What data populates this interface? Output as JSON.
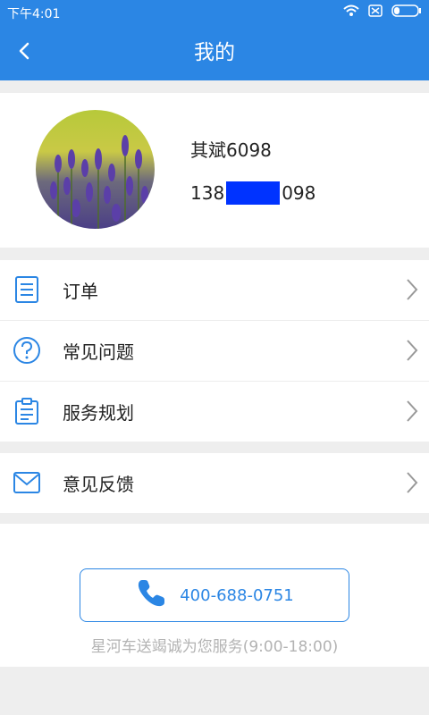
{
  "status_bar": {
    "time": "下午4:01",
    "icons": [
      "wifi-icon",
      "sim-off-icon",
      "battery-icon"
    ]
  },
  "header": {
    "title": "我的",
    "back_icon": "chevron-left-icon"
  },
  "profile": {
    "name": "其斌6098",
    "phone_prefix": "138",
    "phone_suffix": "098",
    "avatar_icon": "lavender-avatar"
  },
  "menu": [
    {
      "label": "订单",
      "icon": "order-list-icon"
    },
    {
      "label": "常见问题",
      "icon": "question-icon"
    },
    {
      "label": "服务规划",
      "icon": "clipboard-icon"
    }
  ],
  "menu2": [
    {
      "label": "意见反馈",
      "icon": "mail-icon"
    }
  ],
  "service": {
    "phone": "400-688-0751",
    "note": "星河车送竭诚为您服务(9:00-18:00)"
  },
  "colors": {
    "primary": "#2b86e4",
    "background": "#eeeeee"
  }
}
